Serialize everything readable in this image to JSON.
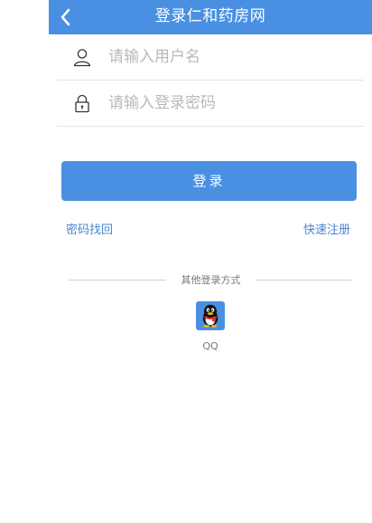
{
  "header": {
    "title": "登录仁和药房网",
    "back_icon": "chevron-left-icon"
  },
  "form": {
    "username": {
      "placeholder": "请输入用户名",
      "value": "",
      "icon": "user-icon"
    },
    "password": {
      "placeholder": "请输入登录密码",
      "value": "",
      "icon": "lock-icon"
    },
    "login_label": "登录"
  },
  "links": {
    "forgot_password": "密码找回",
    "register": "快速注册"
  },
  "other_login": {
    "title": "其他登录方式",
    "providers": [
      {
        "label": "QQ",
        "icon": "qq-icon"
      }
    ]
  },
  "colors": {
    "accent": "#4a90e2",
    "link": "#4a86cf",
    "placeholder": "#b9b9b9",
    "divider": "#e3e3e3"
  }
}
